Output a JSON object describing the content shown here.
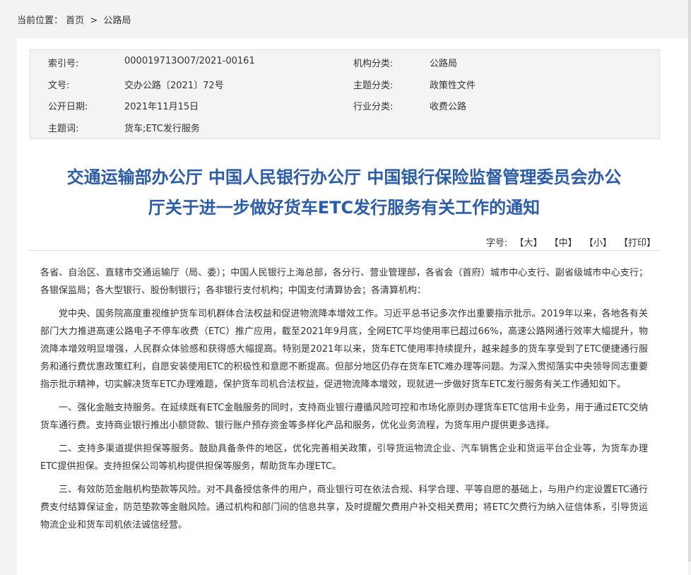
{
  "breadcrumb": {
    "label": "当前位置：",
    "home": "首页",
    "separator": ">",
    "current": "公路局"
  },
  "meta": {
    "index_label": "索引号:",
    "index_value": "000019713O07/2021-00161",
    "org_label": "机构分类:",
    "org_value": "公路局",
    "doc_no_label": "文号:",
    "doc_no_value": "交办公路〔2021〕72号",
    "topic_cat_label": "主题分类:",
    "topic_cat_value": "政策性文件",
    "date_label": "公开日期:",
    "date_value": "2021年11月15日",
    "industry_label": "行业分类:",
    "industry_value": "收费公路",
    "keyword_label": "主题词:",
    "keyword_value": "货车;ETC发行服务"
  },
  "title": {
    "line1": "交通运输部办公厅 中国人民银行办公厅 中国银行保险监督管理委员会办公",
    "line2": "厅关于进一步做好货车ETC发行服务有关工作的通知"
  },
  "fontsize": {
    "label": "字号:",
    "large": "【大】",
    "medium": "【中】",
    "small": "【小】",
    "print": "【打印】"
  },
  "body": {
    "p1": "各省、自治区、直辖市交通运输厅（局、委）；中国人民银行上海总部，各分行、营业管理部，各省会（首府）城市中心支行、副省级城市中心支行；各银保监局；各大型银行、股份制银行；各非银行支付机构；中国支付清算协会；各清算机构：",
    "p2": "党中央、国务院高度重视维护货车司机群体合法权益和促进物流降本增效工作。习近平总书记多次作出重要指示批示。2019年以来，各地各有关部门大力推进高速公路电子不停车收费（ETC）推广应用，截至2021年9月底，全网ETC平均使用率已超过66%，高速公路网通行效率大幅提升，物流降本增效明显增强，人民群众体验感和获得感大幅提高。特别是2021年以来，货车ETC使用率持续提升，越来越多的货车享受到了ETC便捷通行服务和通行费优惠政策红利，自愿安装使用ETC的积极性和意愿不断提高。但部分地区仍存在货车ETC难办理等问题。为深入贯彻落实中央领导同志重要指示批示精神，切实解决货车ETC办理难题，保护货车司机合法权益，促进物流降本增效，现就进一步做好货车ETC发行服务有关工作通知如下。",
    "p3": "一、强化金融支持服务。在延续既有ETC金融服务的同时，支持商业银行遵循风险可控和市场化原则办理货车ETC信用卡业务，用于通过ETC交纳货车通行费。支持商业银行推出小额贷款、银行账户预存资金等多样化产品和服务，优化业务流程，为货车用户提供更多选择。",
    "p4": "二、支持多渠道提供担保等服务。鼓励具备条件的地区，优化完善相关政策，引导货运物流企业、汽车销售企业和货运平台企业等，为货车办理ETC提供担保。支持担保公司等机构提供担保等服务，帮助货车办理ETC。",
    "p5": "三、有效防范金融机构垫款等风险。对不具备授信条件的用户，商业银行可在依法合规、科学合理、平等自愿的基础上，与用户约定设置ETC通行费支付结算保证金，防范垫款等金融风险。通过机构和部门间的信息共享，及时提醒欠费用户补交相关费用；将ETC欠费行为纳入征信体系，引导货运物流企业和货车司机依法诚信经营。"
  }
}
